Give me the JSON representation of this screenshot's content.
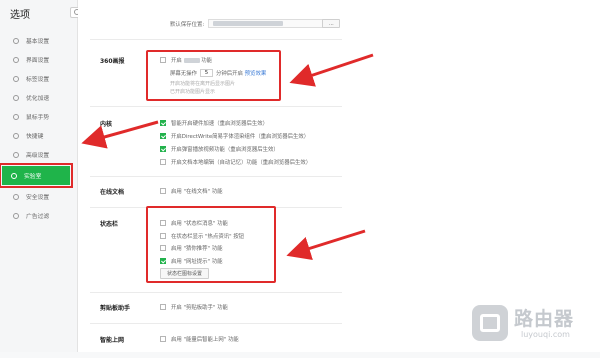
{
  "window": {
    "title": "选项"
  },
  "sidebar": {
    "items": [
      {
        "label": "基本设置",
        "icon": "gear-icon"
      },
      {
        "label": "界面设置",
        "icon": "window-icon"
      },
      {
        "label": "标签设置",
        "icon": "tag-icon"
      },
      {
        "label": "优化加速",
        "icon": "rocket-icon"
      },
      {
        "label": "鼠标手势",
        "icon": "mouse-icon"
      },
      {
        "label": "快捷键",
        "icon": "keyboard-icon"
      },
      {
        "label": "高级设置",
        "icon": "tools-icon"
      },
      {
        "label": "实验室",
        "icon": "flask-icon",
        "active": true
      },
      {
        "label": "安全设置",
        "icon": "shield-icon"
      },
      {
        "label": "广告过滤",
        "icon": "filter-icon"
      }
    ],
    "accent": "#1fb44a"
  },
  "search": {
    "placeholder": ""
  },
  "download": {
    "label": "默认保存位置:",
    "button": "..."
  },
  "sections": {
    "s360": {
      "title": "360画报",
      "enable_label": "开启",
      "enable_suffix": "功能",
      "interval_prefix": "屏幕无操作",
      "interval_value": "5",
      "interval_suffix": "分钟后开启",
      "interval_link": "预览效果",
      "note1": "开启功能将在离开后显示图片",
      "note2": "已开启功能图片显示"
    },
    "kernel": {
      "title": "内核",
      "options": [
        {
          "label": "智能开启硬件加速（重启浏览器后生效）",
          "checked": true
        },
        {
          "label": "开启DirectWrite简易字体渲染组件（重启浏览器后生效）",
          "checked": true
        },
        {
          "label": "开启弹窗播放视频功能（重启浏览器后生效）",
          "checked": true
        },
        {
          "label": "开启文档本地编辑（自动记忆）功能（重启浏览器后生效）",
          "checked": false
        }
      ]
    },
    "online_doc": {
      "title": "在线文档",
      "label": "启用 \"在线文档\" 功能",
      "checked": false
    },
    "statusbar": {
      "title": "状态栏",
      "options": [
        {
          "label": "启用 \"状态栏消息\" 功能",
          "checked": false
        },
        {
          "label": "在状态栏显示 \"热点资讯\" 按钮",
          "checked": false
        },
        {
          "label": "启用 \"猜你推荐\" 功能",
          "checked": false
        },
        {
          "label": "启用 \"网址提示\" 功能",
          "checked": true
        }
      ],
      "button": "状态栏图标设置"
    },
    "clipboard": {
      "title": "剪贴板助手",
      "label": "开启 \"剪贴板助手\" 功能",
      "checked": false
    },
    "smart_net": {
      "title": "智能上网",
      "label": "启用 \"能量后智能上网\" 功能",
      "checked": false
    }
  },
  "watermark": {
    "text": "路由器",
    "sub": "luyouqi.com"
  },
  "colors": {
    "highlight": "#e02a2a",
    "checkbox": "#22b24c"
  }
}
